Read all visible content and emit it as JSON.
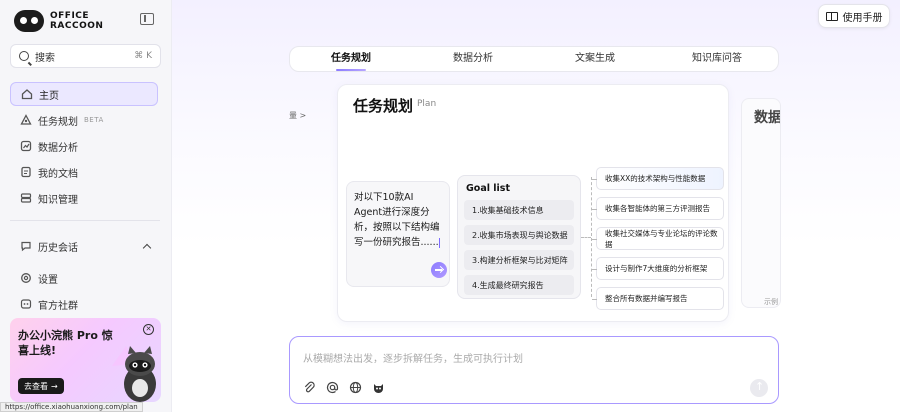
{
  "brand": {
    "line1": "OFFICE",
    "line2": "RACCOON"
  },
  "sidebar": {
    "search": {
      "label": "搜索",
      "shortcut": "⌘ K"
    },
    "items": [
      {
        "label": "主页"
      },
      {
        "label": "任务规划",
        "badge": "BETA"
      },
      {
        "label": "数据分析"
      },
      {
        "label": "我的文档"
      },
      {
        "label": "知识管理"
      }
    ],
    "history_label": "历史会话",
    "settings_label": "设置",
    "community_label": "官方社群",
    "promo": {
      "title": "办公小浣熊 Pro 惊喜上线!",
      "button": "去查看"
    }
  },
  "status_url": "https://office.xiaohuanxiong.com/plan",
  "header": {
    "manual_label": "使用手册"
  },
  "tabs": [
    {
      "label": "任务规划"
    },
    {
      "label": "数据分析"
    },
    {
      "label": "文案生成"
    },
    {
      "label": "知识库问答"
    }
  ],
  "card": {
    "title": "任务规划",
    "subtitle": "Plan",
    "prompt": "对以下10款AI Agent进行深度分析，按照以下结构编写一份研究报告......",
    "goal_title": "Goal list",
    "goals": [
      "1.收集基础技术信息",
      "2.收集市场表现与舆论数据",
      "3.构建分析框架与比对矩阵",
      "4.生成最终研究报告"
    ],
    "tasks": [
      "收集XX的技术架构与性能数据",
      "收集各智能体的第三方评测报告",
      "收集社交媒体与专业论坛的评论数据",
      "设计与制作7大维度的分析框架",
      "整合所有数据并编写报告"
    ]
  },
  "side_left": {
    "peek": "量 >"
  },
  "side_right": {
    "peek_title": "数据",
    "peek_sub": "示例"
  },
  "input": {
    "placeholder": "从模糊想法出发，逐步拆解任务，生成可执行计划"
  }
}
